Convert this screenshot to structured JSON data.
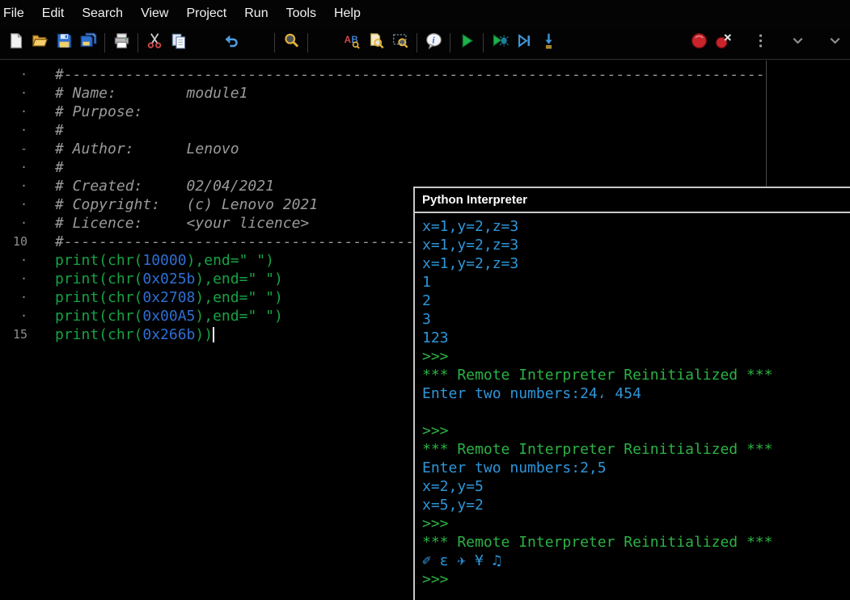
{
  "colors": {
    "code_green": "#16A344",
    "number_blue": "#2E6FD4",
    "comment_gray": "#9A9A9A",
    "output_blue": "#2E96D9",
    "prompt_green": "#2BB244",
    "run_green": "#1FB14E",
    "stop_red": "#C9242B"
  },
  "menubar": {
    "items": [
      "File",
      "Edit",
      "Search",
      "View",
      "Project",
      "Run",
      "Tools",
      "Help"
    ]
  },
  "toolbar": {
    "items": [
      "new-file",
      "open-folder",
      "save",
      "save-all",
      "|",
      "print",
      "|",
      "cut",
      "copy",
      "~",
      "undo",
      "~",
      "|",
      "find",
      "|",
      "~",
      "find-replace",
      "find-in-files",
      "find-region",
      "|",
      "info",
      "|",
      "run",
      "|",
      "debug",
      "run-to-cursor",
      "step-into",
      "*",
      "stop",
      "disconnect",
      "s",
      "overflow",
      "s",
      "chevron-down",
      "s",
      "chevron-down"
    ]
  },
  "editor": {
    "lines": [
      {
        "gutter": "·",
        "tokens": [
          {
            "s": "comment",
            "t": "#--------------------------------------------------------------------------------"
          }
        ]
      },
      {
        "gutter": "·",
        "tokens": [
          {
            "s": "comment",
            "t": "# Name:        module1"
          }
        ]
      },
      {
        "gutter": "·",
        "tokens": [
          {
            "s": "comment",
            "t": "# Purpose:"
          }
        ]
      },
      {
        "gutter": "·",
        "tokens": [
          {
            "s": "comment",
            "t": "#"
          }
        ]
      },
      {
        "gutter": "-",
        "tokens": [
          {
            "s": "comment",
            "t": "# Author:      Lenovo"
          }
        ]
      },
      {
        "gutter": "·",
        "tokens": [
          {
            "s": "comment",
            "t": "#"
          }
        ]
      },
      {
        "gutter": "·",
        "tokens": [
          {
            "s": "comment",
            "t": "# Created:     02/04/2021"
          }
        ]
      },
      {
        "gutter": "·",
        "tokens": [
          {
            "s": "comment",
            "t": "# Copyright:   (c) Lenovo 2021"
          }
        ]
      },
      {
        "gutter": "·",
        "tokens": [
          {
            "s": "comment",
            "t": "# Licence:     <your licence>"
          }
        ]
      },
      {
        "gutter": "10",
        "tokens": [
          {
            "s": "comment",
            "t": "#--------------------------------------------------------------------------------"
          }
        ]
      },
      {
        "gutter": "·",
        "tokens": [
          {
            "s": "code",
            "t": "print(chr("
          },
          {
            "s": "num",
            "t": "10000"
          },
          {
            "s": "code",
            "t": "),end="
          },
          {
            "s": "str",
            "t": "\" \""
          },
          {
            "s": "code",
            "t": ")"
          }
        ]
      },
      {
        "gutter": "·",
        "tokens": [
          {
            "s": "code",
            "t": "print(chr("
          },
          {
            "s": "num",
            "t": "0x025b"
          },
          {
            "s": "code",
            "t": "),end="
          },
          {
            "s": "str",
            "t": "\" \""
          },
          {
            "s": "code",
            "t": ")"
          }
        ]
      },
      {
        "gutter": "·",
        "tokens": [
          {
            "s": "code",
            "t": "print(chr("
          },
          {
            "s": "num",
            "t": "0x2708"
          },
          {
            "s": "code",
            "t": "),end="
          },
          {
            "s": "str",
            "t": "\" \""
          },
          {
            "s": "code",
            "t": ")"
          }
        ]
      },
      {
        "gutter": "·",
        "tokens": [
          {
            "s": "code",
            "t": "print(chr("
          },
          {
            "s": "num",
            "t": "0x00A5"
          },
          {
            "s": "code",
            "t": "),end="
          },
          {
            "s": "str",
            "t": "\" \""
          },
          {
            "s": "code",
            "t": ")"
          }
        ]
      },
      {
        "gutter": "15",
        "tokens": [
          {
            "s": "code",
            "t": "print(chr("
          },
          {
            "s": "num",
            "t": "0x266b"
          },
          {
            "s": "code",
            "t": "))"
          }
        ],
        "cursor": true
      }
    ]
  },
  "interpreter": {
    "title": "Python Interpreter",
    "lines": [
      {
        "color": "blue",
        "text": "x=1,y=2,z=3"
      },
      {
        "color": "blue",
        "text": "x=1,y=2,z=3"
      },
      {
        "color": "blue",
        "text": "x=1,y=2,z=3"
      },
      {
        "color": "blue",
        "text": "1"
      },
      {
        "color": "blue",
        "text": "2"
      },
      {
        "color": "blue",
        "text": "3"
      },
      {
        "color": "blue",
        "text": "123"
      },
      {
        "color": "green",
        "text": ">>>"
      },
      {
        "color": "green",
        "text": "*** Remote Interpreter Reinitialized ***"
      },
      {
        "color": "blue",
        "text": "Enter two numbers:24، 454"
      },
      {
        "color": "blue",
        "text": ""
      },
      {
        "color": "green",
        "text": ">>>"
      },
      {
        "color": "green",
        "text": "*** Remote Interpreter Reinitialized ***"
      },
      {
        "color": "blue",
        "text": "Enter two numbers:2,5"
      },
      {
        "color": "blue",
        "text": "x=2,y=5"
      },
      {
        "color": "blue",
        "text": "x=5,y=2"
      },
      {
        "color": "green",
        "text": ">>>"
      },
      {
        "color": "green",
        "text": "*** Remote Interpreter Reinitialized ***"
      },
      {
        "color": "blue",
        "text": "✐ ɛ ✈ ¥ ♫"
      },
      {
        "color": "green",
        "text": ">>>"
      }
    ]
  }
}
